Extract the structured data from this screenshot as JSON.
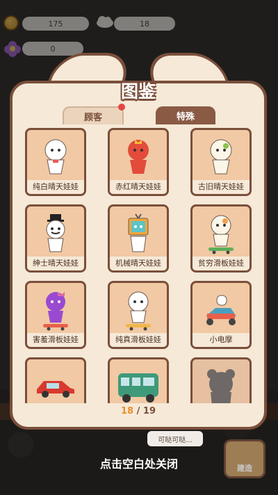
{
  "hud": {
    "coins": "175",
    "cloud_count": "18",
    "flower_count": "0"
  },
  "panel": {
    "title": "图鉴",
    "tabs": [
      {
        "label": "顾客",
        "active": false,
        "has_notification": true
      },
      {
        "label": "特殊",
        "active": true
      }
    ],
    "items": [
      {
        "label": "纯白晴天娃娃",
        "icon": "white-doll-icon"
      },
      {
        "label": "赤红晴天娃娃",
        "icon": "red-doll-icon"
      },
      {
        "label": "古旧晴天娃娃",
        "icon": "old-doll-icon"
      },
      {
        "label": "绅士晴天娃娃",
        "icon": "gentleman-doll-icon"
      },
      {
        "label": "机械晴天娃娃",
        "icon": "robot-doll-icon"
      },
      {
        "label": "贫穷滑板娃娃",
        "icon": "poor-skate-doll-icon"
      },
      {
        "label": "害羞滑板娃娃",
        "icon": "shy-skate-doll-icon"
      },
      {
        "label": "纯真滑板娃娃",
        "icon": "pure-skate-doll-icon"
      },
      {
        "label": "小电摩",
        "icon": "scooter-icon"
      },
      {
        "label": "",
        "icon": "red-car-icon"
      },
      {
        "label": "",
        "icon": "green-van-icon"
      },
      {
        "label": "",
        "icon": "locked-silhouette-icon"
      }
    ],
    "counter_current": "18",
    "counter_sep": " / ",
    "counter_total": "19"
  },
  "bottom": {
    "speech": "可哒可哒...",
    "close_hint": "点击空白处关闭",
    "build_label": "建造"
  },
  "colors": {
    "panel_bg": "#f6e9d8",
    "panel_border": "#7a4f3b",
    "card_bg": "#f1c9a4",
    "active_tab": "#8a5a45",
    "counter_accent": "#e8902d"
  }
}
